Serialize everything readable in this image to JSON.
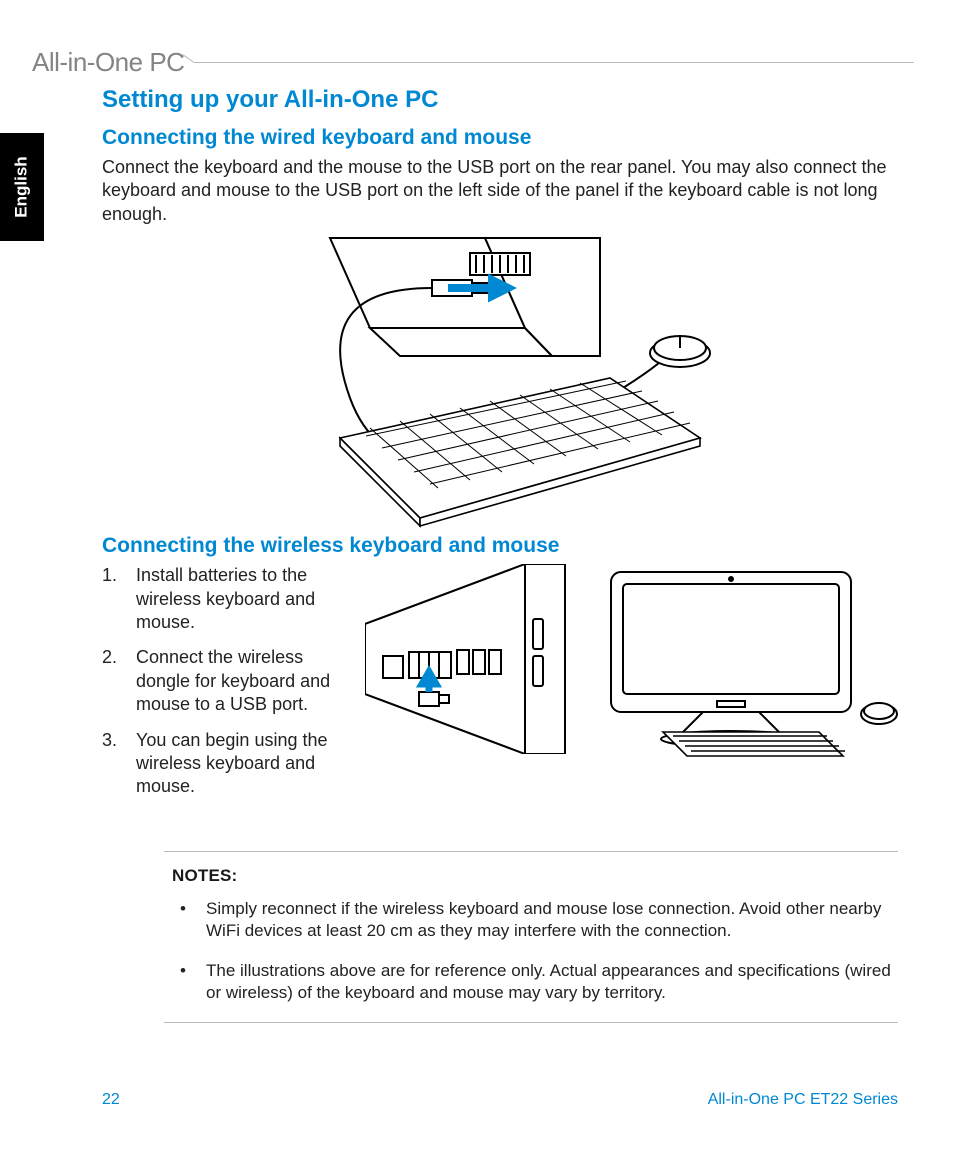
{
  "header": {
    "title": "All-in-One PC"
  },
  "lang_tab": "English",
  "h1": "Setting up your All-in-One PC",
  "section_wired": {
    "heading": "Connecting the wired keyboard and mouse",
    "paragraph": "Connect the keyboard and the mouse to the USB port on the rear panel. You may also connect the keyboard and mouse to the USB port on the left side of the panel if the keyboard cable is not long enough."
  },
  "section_wireless": {
    "heading": "Connecting the wireless keyboard and mouse",
    "steps": [
      "Install batteries to the wireless keyboard and mouse.",
      "Connect the wireless dongle for keyboard and mouse to a USB port.",
      "You can begin using the wireless keyboard and mouse."
    ]
  },
  "notes": {
    "label": "NOTES:",
    "items": [
      "Simply reconnect if the wireless keyboard and mouse lose connection.  Avoid other nearby WiFi devices at least 20 cm as they may interfere with the connection.",
      "The illustrations above are for reference only. Actual appearances and specifications (wired or wireless) of the keyboard and mouse may vary by territory."
    ]
  },
  "footer": {
    "page": "22",
    "series": "All-in-One PC ET22 Series"
  }
}
